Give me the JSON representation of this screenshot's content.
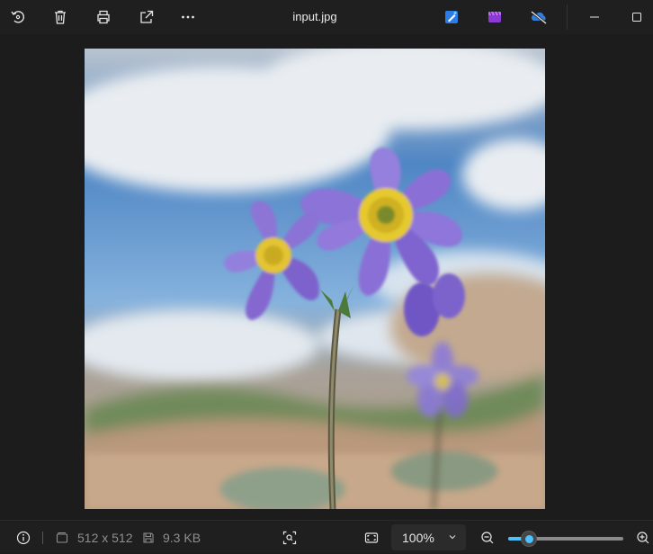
{
  "window": {
    "title": "input.jpg"
  },
  "toolbar": {
    "items": [
      {
        "name": "rotate-button",
        "icon": "rotate-icon"
      },
      {
        "name": "delete-button",
        "icon": "trash-icon"
      },
      {
        "name": "print-button",
        "icon": "printer-icon"
      },
      {
        "name": "share-button",
        "icon": "share-icon"
      },
      {
        "name": "more-button",
        "icon": "more-icon"
      }
    ],
    "apps": [
      {
        "name": "edit-app-button",
        "icon": "paint-icon"
      },
      {
        "name": "clipchamp-button",
        "icon": "clipchamp-icon"
      },
      {
        "name": "onedrive-button",
        "icon": "onedrive-off-icon"
      }
    ]
  },
  "image": {
    "description_icon": "flower-photo"
  },
  "status": {
    "dimensions": "512 x 512",
    "file_size": "9.3 KB",
    "zoom": "100%",
    "zoom_level": 0.18
  },
  "colors": {
    "accent": "#4cc2ff",
    "background": "#1c1c1c"
  }
}
